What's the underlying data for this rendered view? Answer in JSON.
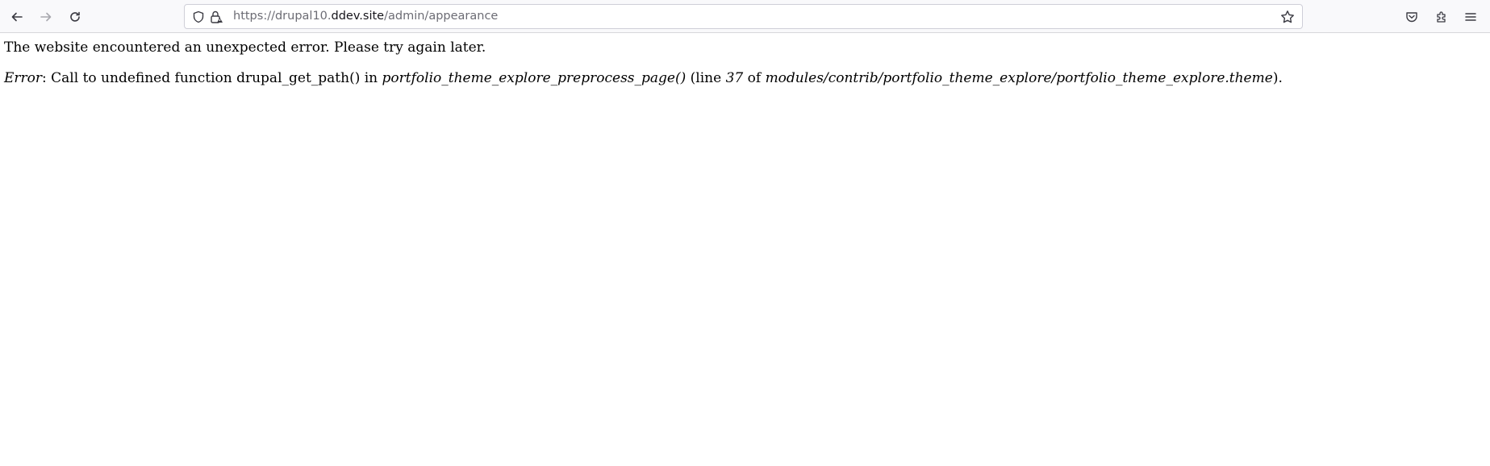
{
  "browser": {
    "url": {
      "prefix": "https://drupal10.",
      "host": "ddev.site",
      "path": "/admin/appearance"
    },
    "icons": {
      "back": "back-arrow-icon",
      "forward": "forward-arrow-icon",
      "reload": "reload-icon",
      "shield": "tracking-protection-shield-icon",
      "lock": "lock-icon",
      "bookmark": "bookmark-star-icon",
      "pocket": "pocket-icon",
      "extensions": "extensions-puzzle-icon",
      "menu": "hamburger-menu-icon"
    }
  },
  "page": {
    "message": "The website encountered an unexpected error. Please try again later.",
    "error": {
      "label": "Error",
      "text1": ": Call to undefined function drupal_get_path() in ",
      "function": "portfolio_theme_explore_preprocess_page()",
      "text2": " (line ",
      "line": "37",
      "text3": " of ",
      "file": "modules/contrib/portfolio_theme_explore/portfolio_theme_explore.theme",
      "text4": ")."
    }
  }
}
